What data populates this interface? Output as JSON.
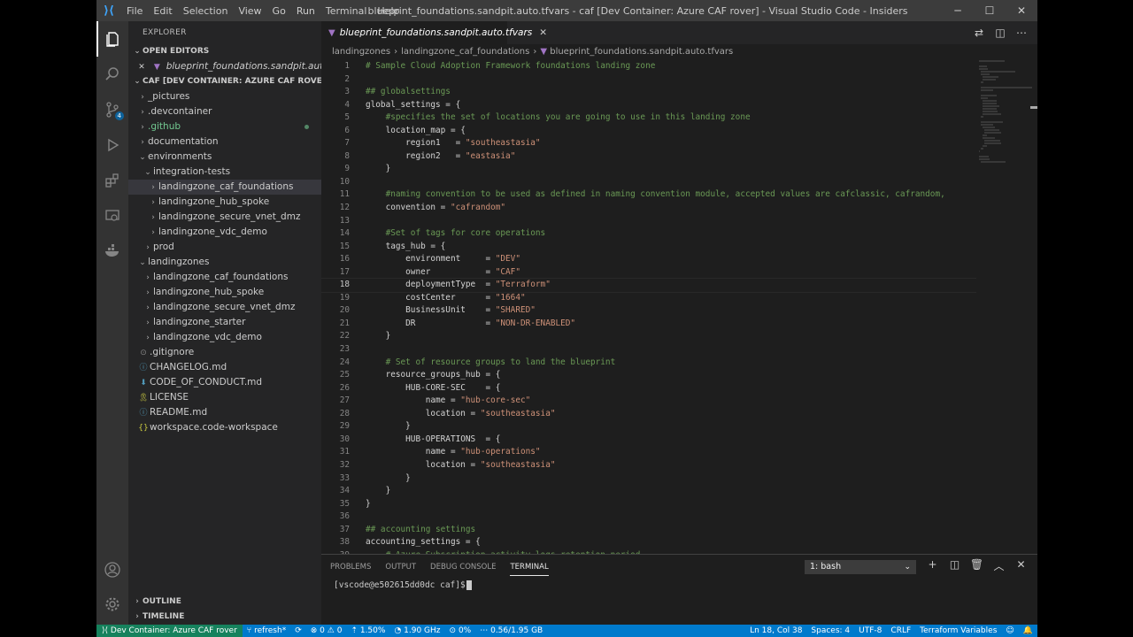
{
  "titlebar": {
    "menu": [
      "File",
      "Edit",
      "Selection",
      "View",
      "Go",
      "Run",
      "Terminal",
      "Help"
    ],
    "title": "blueprint_foundations.sandpit.auto.tfvars - caf [Dev Container: Azure CAF rover] - Visual Studio Code - Insiders"
  },
  "sidebar": {
    "title": "EXPLORER",
    "open_editors_label": "OPEN EDITORS",
    "open_editor_file": "blueprint_foundations.sandpit.auto.tfv...",
    "workspace_label": "CAF [DEV CONTAINER: AZURE CAF ROVER]",
    "tree": [
      {
        "label": "_pictures",
        "kind": "folder"
      },
      {
        "label": ".devcontainer",
        "kind": "folder"
      },
      {
        "label": ".github",
        "kind": "folder"
      },
      {
        "label": "documentation",
        "kind": "folder"
      },
      {
        "label": "environments",
        "kind": "folder-open"
      },
      {
        "label": "integration-tests",
        "kind": "folder-open"
      },
      {
        "label": "landingzone_caf_foundations",
        "kind": "folder"
      },
      {
        "label": "landingzone_hub_spoke",
        "kind": "folder"
      },
      {
        "label": "landingzone_secure_vnet_dmz",
        "kind": "folder"
      },
      {
        "label": "landingzone_vdc_demo",
        "kind": "folder"
      },
      {
        "label": "prod",
        "kind": "folder"
      },
      {
        "label": "landingzones",
        "kind": "folder-open"
      },
      {
        "label": "landingzone_caf_foundations",
        "kind": "folder"
      },
      {
        "label": "landingzone_hub_spoke",
        "kind": "folder"
      },
      {
        "label": "landingzone_secure_vnet_dmz",
        "kind": "folder"
      },
      {
        "label": "landingzone_starter",
        "kind": "folder"
      },
      {
        "label": "landingzone_vdc_demo",
        "kind": "folder"
      },
      {
        "label": ".gitignore",
        "kind": "file"
      },
      {
        "label": "CHANGELOG.md",
        "kind": "file"
      },
      {
        "label": "CODE_OF_CONDUCT.md",
        "kind": "file"
      },
      {
        "label": "LICENSE",
        "kind": "file"
      },
      {
        "label": "README.md",
        "kind": "file"
      },
      {
        "label": "workspace.code-workspace",
        "kind": "file"
      }
    ],
    "outline_label": "OUTLINE",
    "timeline_label": "TIMELINE",
    "scm_badge": "4"
  },
  "editor": {
    "tab_label": "blueprint_foundations.sandpit.auto.tfvars",
    "breadcrumb": [
      "landingzones",
      "landingzone_caf_foundations",
      "blueprint_foundations.sandpit.auto.tfvars"
    ],
    "lines": [
      "# Sample Cloud Adoption Framework foundations landing zone",
      "",
      "## globalsettings",
      "global_settings = {",
      "    #specifies the set of locations you are going to use in this landing zone",
      "    location_map = {",
      "        region1   = \"southeastasia\"",
      "        region2   = \"eastasia\"",
      "    }",
      "",
      "    #naming convention to be used as defined in naming convention module, accepted values are cafclassic, cafrandom,",
      "    convention = \"cafrandom\"",
      "",
      "    #Set of tags for core operations",
      "    tags_hub = {",
      "        environment     = \"DEV\"",
      "        owner           = \"CAF\"",
      "        deploymentType  = \"Terraform\"",
      "        costCenter      = \"1664\"",
      "        BusinessUnit    = \"SHARED\"",
      "        DR              = \"NON-DR-ENABLED\"",
      "    }",
      "",
      "    # Set of resource groups to land the blueprint",
      "    resource_groups_hub = {",
      "        HUB-CORE-SEC    = {",
      "            name = \"hub-core-sec\"",
      "            location = \"southeastasia\"",
      "        }",
      "        HUB-OPERATIONS  = {",
      "            name = \"hub-operations\"",
      "            location = \"southeastasia\"",
      "        }",
      "    }",
      "}",
      "",
      "## accounting settings",
      "accounting_settings = {",
      "    # Azure Subscription activity logs retention period"
    ]
  },
  "panel": {
    "tabs": [
      "PROBLEMS",
      "OUTPUT",
      "DEBUG CONSOLE",
      "TERMINAL"
    ],
    "terminal_select": "1: bash",
    "prompt": "[vscode@e502615dd0dc caf]$"
  },
  "statusbar": {
    "remote": "Dev Container: Azure CAF rover",
    "branch": "refresh*",
    "errors": "0",
    "warnings": "0",
    "cpu": "1.50%",
    "freq": "1.90 GHz",
    "load": "0%",
    "mem": "0.56/1.95 GB",
    "position": "Ln 18, Col 38",
    "spaces": "Spaces: 4",
    "encoding": "UTF-8",
    "eol": "CRLF",
    "language": "Terraform Variables"
  },
  "colors": {
    "accent": "#007acc",
    "remote": "#16825d",
    "comment": "#6a9955",
    "string": "#ce9178"
  }
}
